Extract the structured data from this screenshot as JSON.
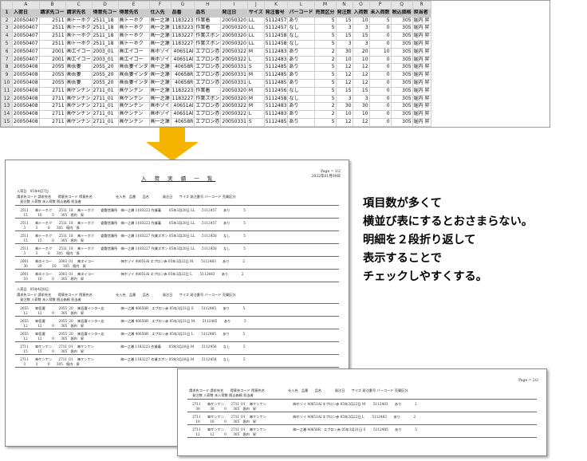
{
  "spreadsheet": {
    "columns": [
      "",
      "A",
      "B",
      "C",
      "D",
      "E",
      "F",
      "G",
      "H",
      "I",
      "J",
      "K",
      "L",
      "M",
      "N",
      "O",
      "P",
      "Q",
      "R"
    ],
    "header": [
      "入荷日",
      "請求先コー",
      "請求先名",
      "得意先コー",
      "得意先名",
      "仕入先",
      "品番",
      "品名",
      "発注日",
      "サイズ",
      "発注番号",
      "バーコード",
      "売買区分",
      "発注数",
      "入荷数",
      "未入荷数",
      "税込価格",
      "担当者"
    ],
    "rows": [
      [
        "20050407",
        "2511",
        "㈱トーホク",
        "2511_18",
        "㈱トーホク",
        "㈱一之瀬",
        "1183223",
        "作業着",
        "20050320",
        "LL",
        "5112457",
        "あり",
        "5",
        "15",
        "10",
        "5",
        "305",
        "堀内",
        "昇"
      ],
      [
        "20050407",
        "2511",
        "㈱トーホク",
        "2511_18",
        "㈱トーホク",
        "㈱一之瀬",
        "1183223",
        "作業着",
        "20050320",
        "LL",
        "5112457",
        "なし",
        "5",
        "3",
        "3",
        "0",
        "305",
        "堀内",
        "昇"
      ],
      [
        "20050407",
        "2511",
        "㈱トーホク",
        "2511_18",
        "㈱トーホク",
        "㈱一之瀬",
        "1183227",
        "作業ズボン",
        "20050320",
        "LL",
        "5112458",
        "なし",
        "5",
        "15",
        "15",
        "0",
        "305",
        "堀内",
        "昇"
      ],
      [
        "20050407",
        "2511",
        "㈱トーホク",
        "2511_18",
        "㈱トーホク",
        "㈱一之瀬",
        "1183227",
        "作業ズボン",
        "20050320",
        "LL",
        "5112458",
        "なし",
        "5",
        "3",
        "3",
        "0",
        "305",
        "堀内",
        "昇"
      ],
      [
        "20050407",
        "2001",
        "㈱エイコー",
        "2003_01",
        "㈱エイコー",
        "㈱ホゾイ",
        "40651Al",
        "エプロン赤",
        "20050322",
        "M",
        "5112483",
        "あり",
        "2",
        "30",
        "20",
        "10",
        "305",
        "堀内",
        "昇"
      ],
      [
        "20050407",
        "2001",
        "㈱エイコー",
        "2003_01",
        "㈱エイコー",
        "㈱ホゾイ",
        "40651Al",
        "エプロン赤",
        "20050322",
        "L",
        "5112483",
        "あり",
        "2",
        "10",
        "10",
        "0",
        "305",
        "堀内",
        "昇"
      ],
      [
        "20050408",
        "2055",
        "㈱吾妻",
        "2055_20",
        "㈱吾妻インタ",
        "㈱一之瀬",
        "40658R",
        "エプロン赤",
        "20050331",
        "S",
        "5112485",
        "あり",
        "5",
        "12",
        "12",
        "0",
        "305",
        "堀内",
        "昇"
      ],
      [
        "20050408",
        "2055",
        "㈱吾妻",
        "2055_20",
        "㈱吾妻インタ",
        "㈱一之瀬",
        "40658R",
        "エプロン赤",
        "20050331",
        "M",
        "5112485",
        "あり",
        "5",
        "12",
        "12",
        "0",
        "305",
        "堀内",
        "昇"
      ],
      [
        "20050408",
        "2055",
        "㈱吾妻",
        "2055_20",
        "㈱吾妻インタ",
        "㈱一之瀬",
        "40658R",
        "エプロン赤",
        "20050331",
        "L",
        "5112485",
        "あり",
        "5",
        "12",
        "12",
        "0",
        "305",
        "堀内",
        "昇"
      ],
      [
        "20050408",
        "2711",
        "㈱ケンナン",
        "2711_01",
        "㈱ケンナン",
        "㈱一之瀬",
        "1183223",
        "作業着",
        "20050320",
        "M",
        "5112456",
        "なし",
        "5",
        "15",
        "15",
        "0",
        "305",
        "堀内",
        "昇"
      ],
      [
        "20050408",
        "2711",
        "㈱ケンナン",
        "2711_01",
        "㈱ケンナン",
        "㈱一之瀬",
        "1183227",
        "作業ズボン",
        "20050320",
        "M",
        "5112458",
        "なし",
        "5",
        "3",
        "3",
        "0",
        "305",
        "堀内",
        "昇"
      ],
      [
        "20050408",
        "2711",
        "㈱ケンナン",
        "2711_01",
        "㈱ケンナン",
        "㈱ホゾイ",
        "40651Al",
        "エプロン赤",
        "20050322",
        "M",
        "5112483",
        "あり",
        "2",
        "30",
        "30",
        "0",
        "305",
        "堀内",
        "昇"
      ],
      [
        "20050408",
        "2711",
        "㈱ケンナン",
        "2711_01",
        "㈱ケンナン",
        "㈱ホゾイ",
        "40651Al",
        "エプロン赤",
        "20050322",
        "L",
        "5112483",
        "あり",
        "2",
        "10",
        "10",
        "0",
        "305",
        "堀内",
        "昇"
      ],
      [
        "20050408",
        "2711",
        "㈱ケンナン",
        "2711_01",
        "㈱ケンナン",
        "㈱一之瀬",
        "40658R",
        "エプロン赤",
        "20050331",
        "S",
        "5112485",
        "あり",
        "5",
        "12",
        "12",
        "0",
        "305",
        "堀内",
        "昇"
      ]
    ]
  },
  "arrow": {
    "color": "#f5b400",
    "icon": "down-arrow-icon"
  },
  "report_page1": {
    "title": "入 荷 実 績 一 覧",
    "page_info": [
      "Page = 1/2",
      "2022年01月09日"
    ],
    "group1_label": "入荷日　05年4月7日",
    "header_line1": "請求先コード 請求先名　　得意先コード 得意先名　　　　　　　仕入先　品番　　品名　　　　発注日　　サイズ 発注番号 バーコード 売買区分",
    "header_line2": "　発注数 入荷数 未入荷数 税込価格 担当者",
    "group1_lines": [
      "　2511　　㈱トーホク　　2511_18　 ㈱トーホク　　倉敷営業所　㈱一之瀬 1183223 作業着　　 05年3月20日 LL　　5112457　　あり　　　　5",
      "　　15　　　10　　　5　　305　堀内　昇",
      "　2511　　㈱トーホク　　2511_18　 ㈱トーホク　　倉敷営業所　㈱一之瀬 1183223 作業着　　 05年3月20日 LL　　5112457　　あり　　　　5",
      "　　3　　　3　　　0　　305　堀内　昇",
      "　2511　　㈱トーホク　　2511_18　 ㈱トーホク　　倉敷営業所　㈱一之瀬 1183227 作業ズボン 05年3月20日 LL　　5112458　　なし　　　　5",
      "　　15　　　15　　　0　　305　堀内　昇",
      "　2511　　㈱トーホク　　2511_18　 ㈱トーホク　　倉敷営業所　㈱一之瀬 1183227 作業ズボン 05年3月20日 LL　　5112458　　なし　　　　5",
      "　　3　　　3　　　0　　305　堀内　昇",
      "　2001　　㈱エイコー　　2003_01　 ㈱エイコー　　　　　　　　㈱ホゾイ 40651Al エプロン赤 05年3月22日 M　　 5112483　　あり　　　　2",
      "　　30　　　20　　　10　　305　堀内　昇",
      "　2001　　㈱エイコー　　2003_01　 ㈱エイコー　　　　　　　　㈱ホゾイ 40651Al エプロン赤 05年3月22日 L　　 5112483　　あり　　　　2",
      "　　10　　　10　　　0　　305　堀内　昇"
    ],
    "group2_label": "入荷日　05年4月8日",
    "group2_lines": [
      "　2055　　㈱吾妻　　　　2055_20　 ㈱吾妻インター店　　　　　㈱一之瀬 40658R　エプロン赤 05年3月31日 S　　 5112485　　あり　　　　5",
      "　　12　　　12　　　0　　305　堀内　昇",
      "　2055　　㈱吾妻　　　　2055_20　 ㈱吾妻インター店　　　　　㈱一之瀬 40658R　エプロン赤 05年3月31日 M　　 5112485　　あり　　　　5",
      "　　12　　　12　　　0　　305　堀内　昇",
      "　2055　　㈱吾妻　　　　2055_20　 ㈱吾妻インター店　　　　　㈱一之瀬 40658R　エプロン赤 05年3月31日 L　　 5112485　　あり　　　　5",
      "　　12　　　12　　　0　　305　堀内　昇",
      "　2711　　㈱ケンナン　　2711_01　 ㈱ケンナン　　　　　　　　㈱一之瀬 1183223 作業着　　 05年3月20日 M　　 5112456　　なし　　　　5",
      "　　15　　　15　　　0　　305　堀内　昇",
      "　2711　　㈱ケンナン　　2711_01　 ㈱ケンナン　　　　　　　　㈱一之瀬 1183227 作業ズボン 05年3月20日 M　　 5112458　　なし　　　　5",
      "　　3　　　3　　　0　　305　堀内　昇"
    ]
  },
  "report_page2": {
    "page_info": [
      "Page = 2/2"
    ],
    "header_line1": "請求先コード 請求先名　　得意先コード 得意先名　　　　　　　仕入先　品番　　品名　　　　発注日　　サイズ 発注番号 バーコード 売買区分",
    "header_line2": "　発注数 入荷数 未入荷数 税込価格 担当者",
    "lines": [
      "　2711　　㈱ケンナン　　2711_01　 ㈱ケンナン　　　　　　　　㈱ホゾイ 40651Al エプロン赤 05年3月22日 M　　 5112483　　あり　　　　2",
      "　　30　　　30　　　0　　305　堀内　昇",
      "　2711　　㈱ケンナン　　2711_01　 ㈱ケンナン　　　　　　　　㈱ホゾイ 40651Al エプロン赤 05年3月22日 L　　 5112483　　あり　　　　2",
      "　　10　　　10　　　0　　305　堀内　昇",
      "　2711　　㈱ケンナン　　2711_01　 ㈱ケンナン　　　　　　　　㈱一之瀬 40658R　エプロン赤 05年3月31日 S　　 5112485　　あり　　　　5",
      "　　12　　　12　　　0　　305　堀内　昇"
    ]
  },
  "callout": {
    "lines": [
      "項目数が多くて",
      "横並び表にするとおさまらない。",
      "明細を２段折り返して",
      "表示することで",
      "チェックしやすくする。"
    ]
  }
}
